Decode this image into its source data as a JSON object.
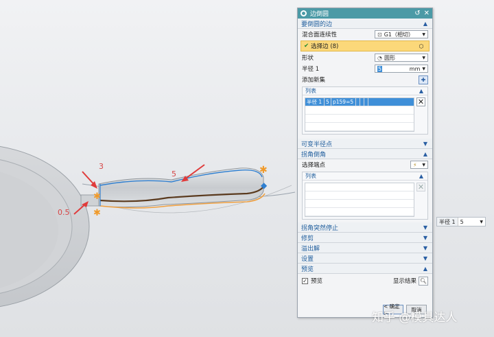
{
  "dialog": {
    "title": "边倒圆",
    "section_edges": {
      "title": "要倒圆的边",
      "continuity_label": "混合面连续性",
      "continuity_value": "G1（相切）",
      "select_edge_label": "选择边 (8)",
      "shape_label": "形状",
      "shape_value": "圆形",
      "radius_label": "半径 1",
      "radius_value": "5",
      "radius_unit": "mm",
      "add_set_label": "添加新集",
      "list_title": "列表",
      "list_row": [
        "半径 1",
        "5",
        "p159=5"
      ]
    },
    "section_variable_radius": {
      "title": "可变半径点"
    },
    "section_corner_setback": {
      "title": "拐角倒角",
      "select_endpoint_label": "选择端点",
      "list_title": "列表"
    },
    "collapsed_sections": [
      "拐角突然停止",
      "修剪",
      "溢出解",
      "设置"
    ],
    "section_preview": {
      "title": "预览",
      "preview_label": "预览",
      "show_result_label": "显示结果"
    },
    "ok_label": "< 确定 >",
    "cancel_label": "取消"
  },
  "viewport": {
    "annotation_labels": [
      "3",
      "5",
      "0.5"
    ]
  },
  "onscreen_input": {
    "label": "半径 1",
    "value": "5"
  },
  "watermark": "知乎 @模具达人",
  "colors": {
    "accent": "#4b9aa6",
    "selection": "#fbd87a",
    "list_selected": "#3f8fd8",
    "arrow": "#e03b3b"
  }
}
